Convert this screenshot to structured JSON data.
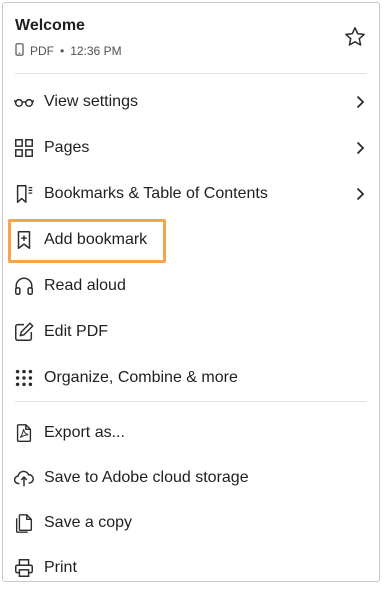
{
  "header": {
    "title": "Welcome",
    "file_type": "PDF",
    "separator": "•",
    "time": "12:36 PM"
  },
  "menu": {
    "group1": [
      {
        "label": "View settings",
        "icon": "glasses-icon",
        "has_chevron": true
      },
      {
        "label": "Pages",
        "icon": "grid-icon",
        "has_chevron": true
      },
      {
        "label": "Bookmarks & Table of Contents",
        "icon": "bookmark-list-icon",
        "has_chevron": true
      },
      {
        "label": "Add bookmark",
        "icon": "bookmark-add-icon",
        "has_chevron": false,
        "highlighted": true
      },
      {
        "label": "Read aloud",
        "icon": "headphones-icon",
        "has_chevron": false
      },
      {
        "label": "Edit PDF",
        "icon": "edit-icon",
        "has_chevron": false
      },
      {
        "label": "Organize, Combine & more",
        "icon": "dots-grid-icon",
        "has_chevron": false
      }
    ],
    "group2": [
      {
        "label": "Export as...",
        "icon": "export-pdf-icon",
        "has_chevron": false
      },
      {
        "label": "Save to Adobe cloud storage",
        "icon": "cloud-upload-icon",
        "has_chevron": false
      },
      {
        "label": "Save a copy",
        "icon": "copy-icon",
        "has_chevron": false
      },
      {
        "label": "Print",
        "icon": "printer-icon",
        "has_chevron": false
      }
    ]
  },
  "colors": {
    "highlight": "#f5a64a",
    "text": "#1f1f1f",
    "divider": "#e3e3e3"
  }
}
